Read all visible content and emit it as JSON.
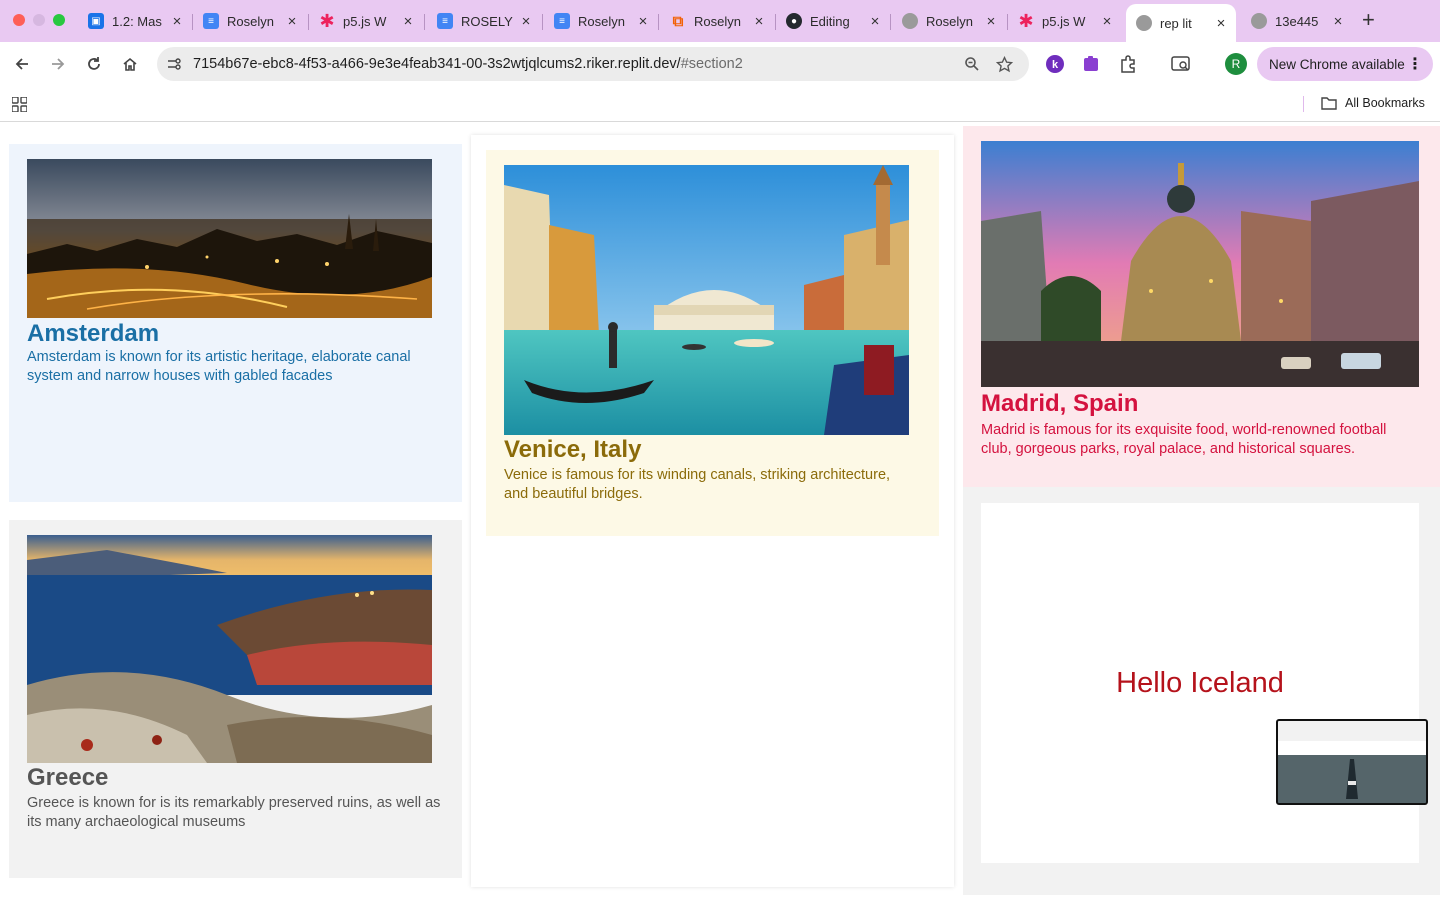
{
  "browser": {
    "tabs": [
      {
        "title": "1.2: Mas",
        "icon": "classroom-icon",
        "color": "#1a73e8"
      },
      {
        "title": "Roselyn",
        "icon": "docs-icon",
        "color": "#4285f4"
      },
      {
        "title": "p5.js W",
        "icon": "p5js-icon",
        "color": "#ed225d"
      },
      {
        "title": "ROSELY",
        "icon": "docs-icon",
        "color": "#4285f4"
      },
      {
        "title": "Roselyn",
        "icon": "docs-icon",
        "color": "#4285f4"
      },
      {
        "title": "Roselyn",
        "icon": "replit-icon",
        "color": "#f26207"
      },
      {
        "title": "Editing",
        "icon": "github-icon",
        "color": "#24292f"
      },
      {
        "title": "Roselyn",
        "icon": "globe-icon",
        "color": "#8a8a8a"
      },
      {
        "title": "p5.js W",
        "icon": "p5js-icon",
        "color": "#ed225d"
      },
      {
        "title": "rep lit",
        "icon": "globe-icon",
        "color": "#8a8a8a",
        "active": true
      },
      {
        "title": "13e445",
        "icon": "globe-icon",
        "color": "#8a8a8a"
      }
    ],
    "url_main": "7154b67e-ebc8-4f53-a466-9e3e4feab341-00-3s2wtjqlcums2.riker.replit.dev/",
    "url_hash": "#section2",
    "update_label": "New Chrome available",
    "profile_initial": "R",
    "all_bookmarks_label": "All Bookmarks",
    "accent": "#e9c9f2"
  },
  "cards": {
    "amsterdam": {
      "title": "Amsterdam",
      "text": "Amsterdam is known for its artistic heritage, elaborate canal system and narrow houses with gabled facades",
      "color": "#1a6fa5"
    },
    "venice": {
      "title": "Venice, Italy",
      "text": "Venice is famous for its winding canals, striking architecture, and beautiful bridges.",
      "color": "#8b6b0a"
    },
    "madrid": {
      "title": "Madrid, Spain",
      "text": "Madrid is famous for its exquisite food, world-renowned football club, gorgeous parks, royal palace, and historical squares.",
      "color": "#d4123f"
    },
    "greece": {
      "title": "Greece",
      "text": "Greece is known for is its remarkably preserved ruins, as well as its many archaeological museums",
      "color": "#555555"
    },
    "iceland": {
      "hello": "Hello Iceland",
      "color": "#b5121b"
    }
  }
}
